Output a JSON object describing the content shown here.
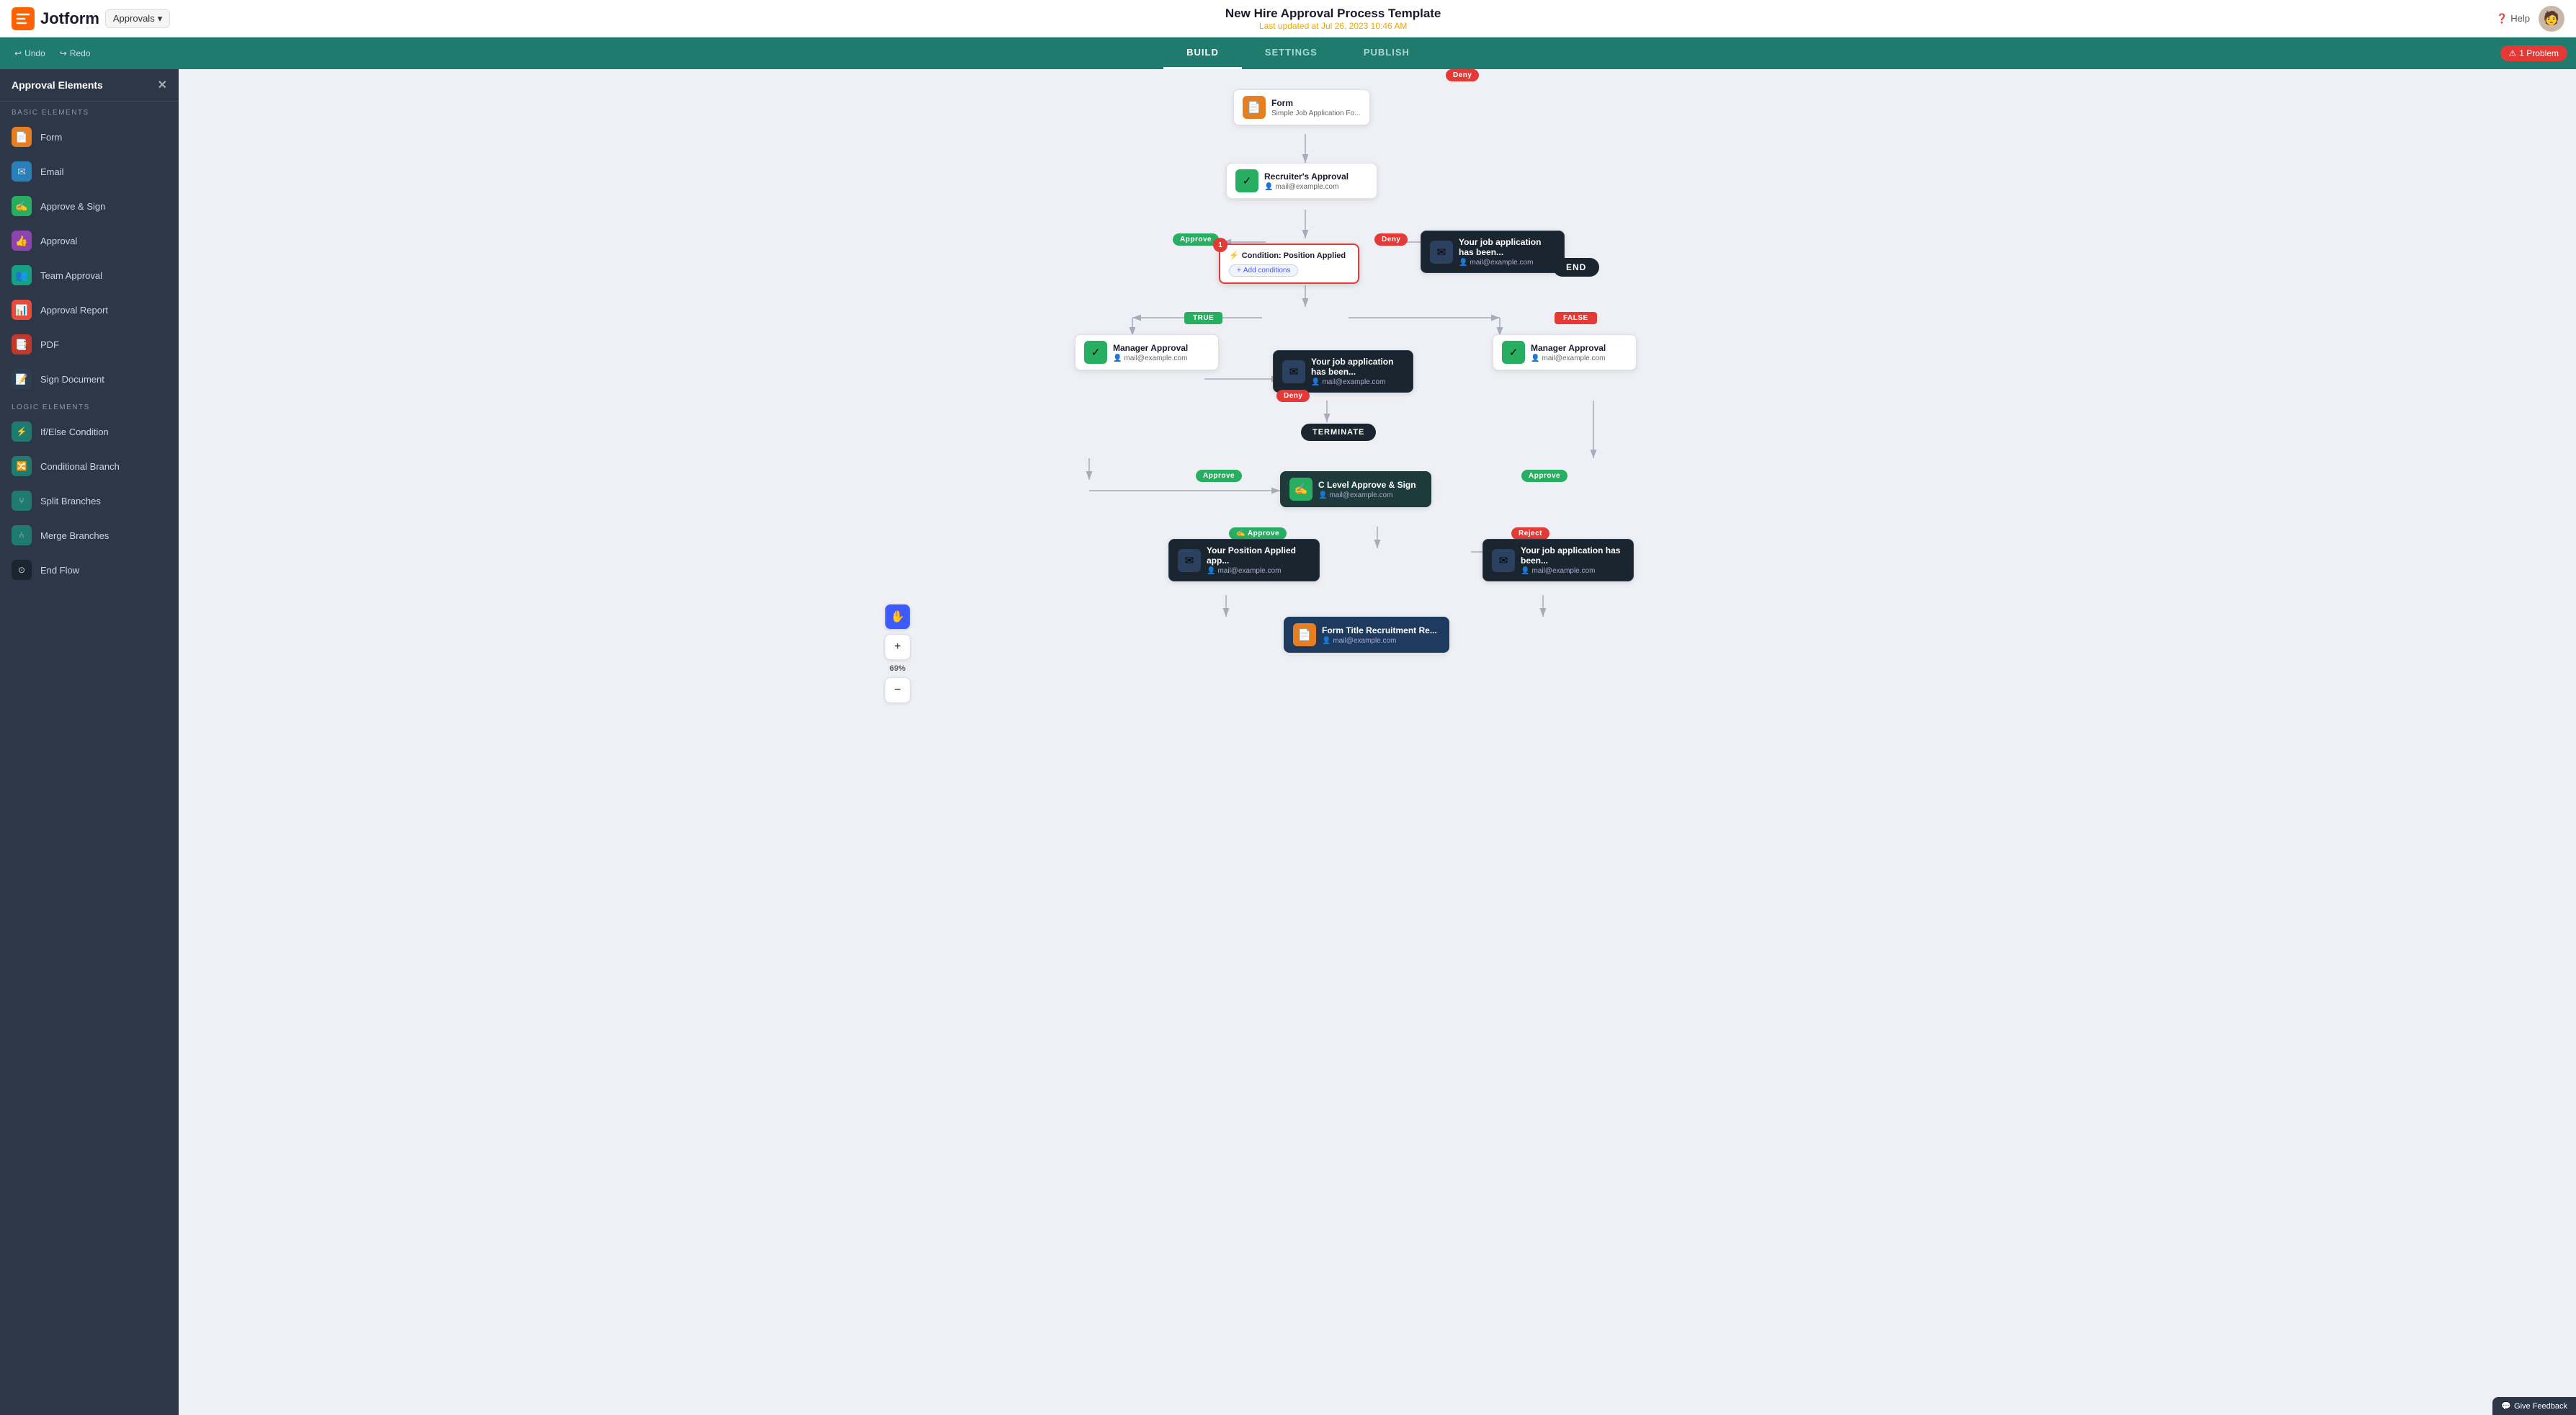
{
  "app": {
    "logo": "Jotform",
    "nav_label": "Approvals",
    "title": "New Hire Approval Process Template",
    "subtitle": "Last updated at Jul 26, 2023 10:46 AM",
    "help": "Help",
    "problem_count": "1 Problem"
  },
  "toolbar": {
    "undo": "Undo",
    "redo": "Redo",
    "tabs": [
      "BUILD",
      "SETTINGS",
      "PUBLISH"
    ],
    "active_tab": "BUILD"
  },
  "sidebar": {
    "title": "Approval Elements",
    "sections": [
      {
        "label": "BASIC ELEMENTS",
        "items": [
          {
            "id": "form",
            "label": "Form",
            "icon": "📄"
          },
          {
            "id": "email",
            "label": "Email",
            "icon": "✉️"
          },
          {
            "id": "approve-sign",
            "label": "Approve & Sign",
            "icon": "✍️"
          },
          {
            "id": "approval",
            "label": "Approval",
            "icon": "👍"
          },
          {
            "id": "team-approval",
            "label": "Team Approval",
            "icon": "👥"
          },
          {
            "id": "approval-report",
            "label": "Approval Report",
            "icon": "📊"
          },
          {
            "id": "pdf",
            "label": "PDF",
            "icon": "📑"
          },
          {
            "id": "sign-document",
            "label": "Sign Document",
            "icon": "📝"
          }
        ]
      },
      {
        "label": "LOGIC ELEMENTS",
        "items": [
          {
            "id": "ifelse",
            "label": "If/Else Condition",
            "icon": "⚡"
          },
          {
            "id": "conditional-branch",
            "label": "Conditional Branch",
            "icon": "🔀"
          },
          {
            "id": "split-branches",
            "label": "Split Branches",
            "icon": "⑂"
          },
          {
            "id": "merge-branches",
            "label": "Merge Branches",
            "icon": "⑃"
          },
          {
            "id": "end-flow",
            "label": "End Flow",
            "icon": "⊙"
          }
        ]
      }
    ]
  },
  "canvas": {
    "zoom": "69%",
    "nodes": {
      "form": {
        "title": "Form",
        "subtitle": "Simple Job Application Fo...",
        "icon": "📄"
      },
      "recruiters_approval": {
        "title": "Recruiter's Approval",
        "email": "mail@example.com"
      },
      "condition": {
        "title": "Condition: Position Applied",
        "btn": "Add conditions",
        "badge": "1"
      },
      "deny_email_1": {
        "title": "Your job application has been...",
        "email": "mail@example.com"
      },
      "end": "END",
      "true_label": "TRUE",
      "false_label": "FALSE",
      "manager_approval_left": {
        "title": "Manager Approval",
        "email": "mail@example.com"
      },
      "deny_email_2": {
        "title": "Your job application has been...",
        "email": "mail@example.com"
      },
      "manager_approval_right": {
        "title": "Manager Approval",
        "email": "mail@example.com"
      },
      "terminate": "TERMINATE",
      "c_level": {
        "title": "C Level Approve & Sign",
        "email": "mail@example.com"
      },
      "position_applied": {
        "title": "Your   Position Applied   app...",
        "email": "mail@example.com"
      },
      "reject_email": {
        "title": "Your job application has been...",
        "email": "mail@example.com"
      },
      "form_title": {
        "title": "Form Title",
        "subtitle": "Recruitment Re...",
        "email": "mail@example.com"
      }
    },
    "badges": {
      "approve_1": "Approve",
      "deny_1": "Deny",
      "true_badge": "TRUE",
      "false_badge": "FALSE",
      "deny_2": "Deny",
      "deny_3": "Deny",
      "approve_left": "Approve",
      "approve_right": "Approve",
      "approve_sign": "Approve",
      "reject": "Reject"
    },
    "feedback": "Give Feedback"
  }
}
